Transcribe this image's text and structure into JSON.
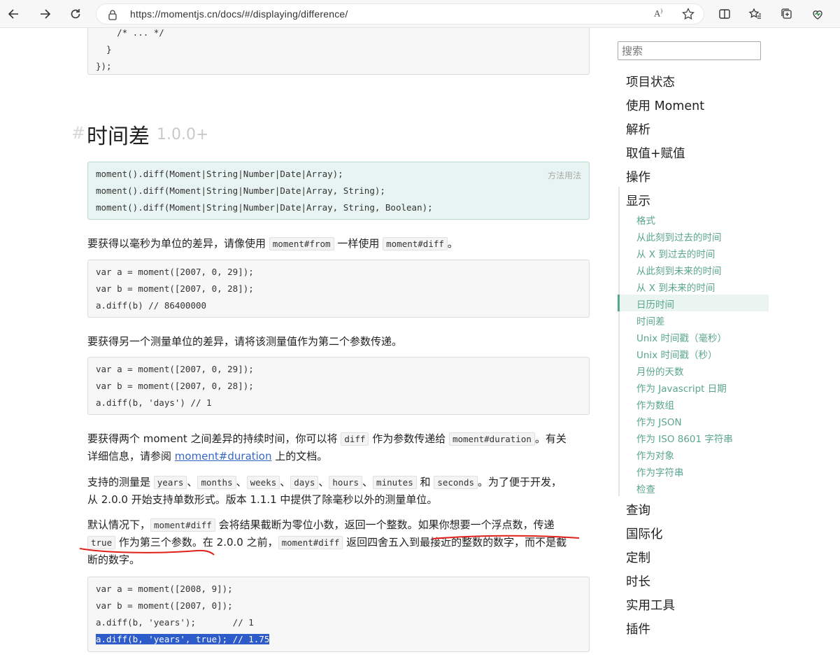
{
  "browser": {
    "url": "https://momentjs.cn/docs/#/displaying/difference/"
  },
  "top_code": {
    "lines": [
      "    /* ... */",
      "  }",
      "});"
    ]
  },
  "section": {
    "hash": "#",
    "title": "时间差",
    "version": "1.0.0+"
  },
  "signature": {
    "tag": "方法用法",
    "lines": [
      "moment().diff(Moment|String|Number|Date|Array);",
      "moment().diff(Moment|String|Number|Date|Array, String);",
      "moment().diff(Moment|String|Number|Date|Array, String, Boolean);"
    ]
  },
  "para1": {
    "t1": "要获得以毫秒为单位的差异，请像使用 ",
    "c1": "moment#from",
    "t2": " 一样使用 ",
    "c2": "moment#diff",
    "t3": "。"
  },
  "code1": {
    "lines": [
      "var a = moment([2007, 0, 29]);",
      "var b = moment([2007, 0, 28]);",
      "a.diff(b) // 86400000"
    ]
  },
  "para2": {
    "text": "要获得另一个测量单位的差异，请将该测量值作为第二个参数传递。"
  },
  "code2": {
    "lines": [
      "var a = moment([2007, 0, 29]);",
      "var b = moment([2007, 0, 28]);",
      "a.diff(b, 'days') // 1"
    ]
  },
  "para3": {
    "t1": "要获得两个 moment 之间差异的持续时间，你可以将 ",
    "c1": "diff",
    "t2": " 作为参数传递给 ",
    "c2": "moment#duration",
    "t3": "。有关",
    "t4": "详细信息，请参阅 ",
    "link": "moment#duration",
    "t5": " 上的文档。"
  },
  "para4": {
    "t1": "支持的测量是 ",
    "units": [
      "years",
      "months",
      "weeks",
      "days",
      "hours",
      "minutes",
      "seconds"
    ],
    "sep": "、",
    "and": "和",
    "t2": "。为了便于开发，",
    "t3": "从 2.0.0 开始支持单数形式。版本 1.1.1 中提供了除毫秒以外的测量单位。"
  },
  "para5": {
    "t1": "默认情况下，",
    "c1": "moment#diff",
    "t2": " 会将结果截断为零位小数，返回一个整数。如果你想要一个浮点数，传递",
    "c2": "true",
    "t3": " 作为第三个参数。在 2.0.0 之前，",
    "c3": "moment#diff",
    "t4": " 返回四舍五入到最接近的整数的数字，而不是截",
    "t5": "断的数字。"
  },
  "code3": {
    "lines": [
      "var a = moment([2008, 9]);",
      "var b = moment([2007, 0]);",
      "a.diff(b, 'years');       // 1"
    ],
    "highlight": "a.diff(b, 'years', true); // 1.75"
  },
  "sidebar": {
    "search_placeholder": "搜索",
    "top": [
      "项目状态",
      "使用 Moment",
      "解析",
      "取值+赋值",
      "操作",
      "显示"
    ],
    "sub": [
      "格式",
      "从此刻到过去的时间",
      "从 X 到过去的时间",
      "从此刻到未来的时间",
      "从 X 到未来的时间",
      "日历时间",
      "时间差",
      "Unix 时间戳（毫秒）",
      "Unix 时间戳（秒）",
      "月份的天数",
      "作为 Javascript 日期",
      "作为数组",
      "作为 JSON",
      "作为 ISO 8601 字符串",
      "作为对象",
      "作为字符串",
      "检查"
    ],
    "bottom": [
      "查询",
      "国际化",
      "定制",
      "时长",
      "实用工具",
      "插件"
    ]
  },
  "colors": {
    "accent": "#5aa58f",
    "link": "#3767c7",
    "highlight": "#2d5bc9",
    "annotation": "#e0201a"
  }
}
